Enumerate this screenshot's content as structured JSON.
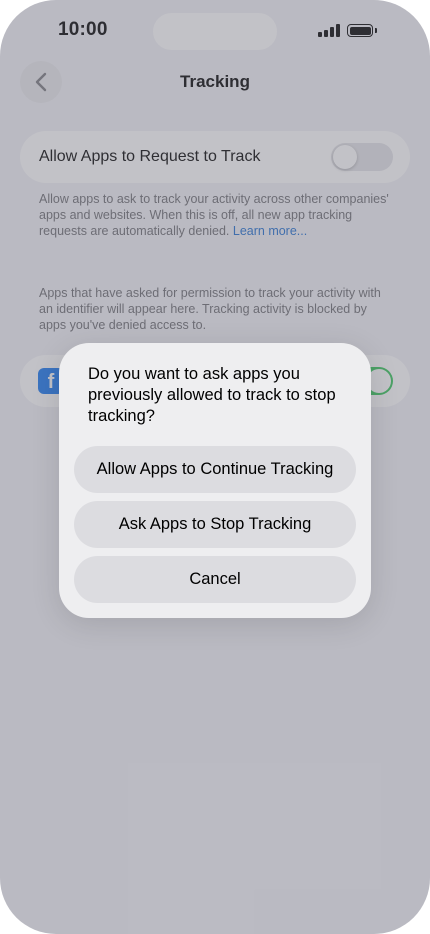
{
  "status_bar": {
    "time": "10:00"
  },
  "nav": {
    "title": "Tracking",
    "back_icon": "chevron-left-icon"
  },
  "settings": {
    "toggle_label": "Allow Apps to Request to Track",
    "toggle_on": false,
    "description": "Allow apps to ask to track your activity across other companies' apps and websites. When this is off, all new app tracking requests are automatically denied.",
    "learn_more": "Learn more...",
    "apps_note": "Apps that have asked for permission to track your activity with an identifier will appear here. Tracking activity is blocked by apps you've denied access to.",
    "app_row": {
      "icon": "facebook-icon",
      "icon_letter": "f",
      "toggle_on": true
    }
  },
  "alert": {
    "message": "Do you want to ask apps you previously allowed to track to stop tracking?",
    "buttons": [
      "Allow Apps to Continue Tracking",
      "Ask Apps to Stop Tracking",
      "Cancel"
    ]
  },
  "colors": {
    "accent": "#1f6fd1",
    "toggle_on": "#34c759",
    "facebook": "#1877f2"
  }
}
